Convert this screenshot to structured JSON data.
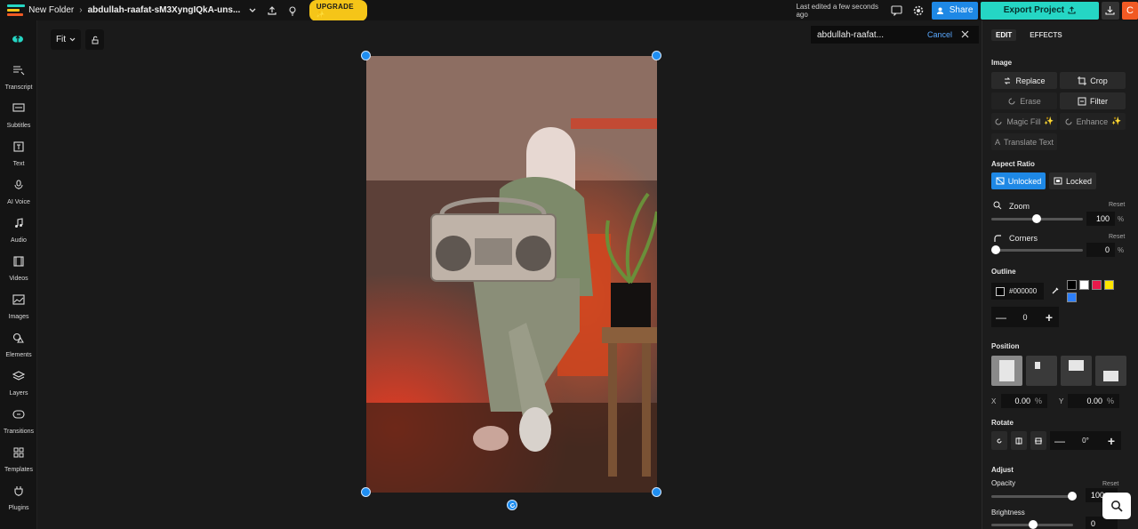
{
  "topbar": {
    "folder": "New Folder",
    "project_name": "abdullah-raafat-sM3XyngIQkA-uns...",
    "upgrade_label": "UPGRADE",
    "last_edited": "Last edited a few seconds ago",
    "share_label": "Share",
    "export_label": "Export Project",
    "avatar_initial": "C"
  },
  "sidebar": {
    "items": [
      {
        "label": "Transcript",
        "icon": "transcript-icon"
      },
      {
        "label": "Subtitles",
        "icon": "subtitles-icon"
      },
      {
        "label": "Text",
        "icon": "text-icon"
      },
      {
        "label": "AI Voice",
        "icon": "ai-voice-icon"
      },
      {
        "label": "Audio",
        "icon": "audio-icon"
      },
      {
        "label": "Videos",
        "icon": "videos-icon"
      },
      {
        "label": "Images",
        "icon": "images-icon"
      },
      {
        "label": "Elements",
        "icon": "elements-icon"
      },
      {
        "label": "Layers",
        "icon": "layers-icon"
      },
      {
        "label": "Transitions",
        "icon": "transitions-icon"
      },
      {
        "label": "Templates",
        "icon": "templates-icon"
      },
      {
        "label": "Plugins",
        "icon": "plugins-icon"
      }
    ]
  },
  "canvas": {
    "fit_label": "Fit",
    "name_field_value": "abdullah-raafat...",
    "cancel_label": "Cancel"
  },
  "panel": {
    "tabs": [
      "EDIT",
      "EFFECTS"
    ],
    "image_section": "Image",
    "replace": "Replace",
    "crop": "Crop",
    "erase": "Erase",
    "filter": "Filter",
    "magic_fill": "Magic Fill",
    "enhance": "Enhance",
    "translate_text": "Translate Text",
    "aspect_ratio": "Aspect Ratio",
    "unlocked": "Unlocked",
    "locked": "Locked",
    "zoom": "Zoom",
    "zoom_value": "100",
    "corners": "Corners",
    "corners_value": "0",
    "reset": "Reset",
    "percent": "%",
    "outline": "Outline",
    "outline_color": "#000000",
    "outline_width": "0",
    "position": "Position",
    "x_label": "X",
    "x_value": "0.00",
    "y_label": "Y",
    "y_value": "0.00",
    "rotate": "Rotate",
    "rotate_value": "0°",
    "adjust": "Adjust",
    "opacity": "Opacity",
    "opacity_value": "100",
    "brightness": "Brightness",
    "brightness_value": "0",
    "swatches": [
      "#000000",
      "#ffffff",
      "#e8194b",
      "#ffe600",
      "#2d7ff9"
    ]
  }
}
